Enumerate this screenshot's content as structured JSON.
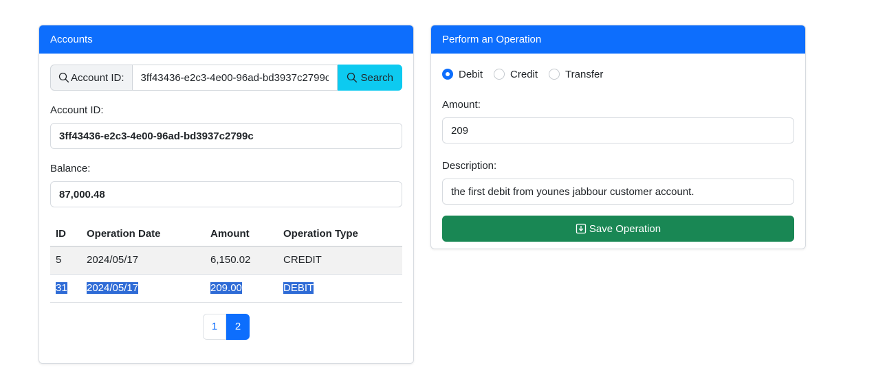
{
  "accounts": {
    "header": "Accounts",
    "search": {
      "label": "Account ID:",
      "value": "3ff43436-e2c3-4e00-96ad-bd3937c2799c",
      "button_label": "Search"
    },
    "account_id_label": "Account ID:",
    "account_id_value": "3ff43436-e2c3-4e00-96ad-bd3937c2799c",
    "balance_label": "Balance:",
    "balance_value": "87,000.48",
    "table": {
      "columns": [
        "ID",
        "Operation Date",
        "Amount",
        "Operation Type"
      ],
      "rows": [
        [
          "5",
          "2024/05/17",
          "6,150.02",
          "CREDIT"
        ],
        [
          "31",
          "2024/05/17",
          "209.00",
          "DEBIT"
        ]
      ]
    },
    "pagination": {
      "pages": [
        "1",
        "2"
      ],
      "active": "2"
    }
  },
  "operation": {
    "header": "Perform an Operation",
    "types": [
      {
        "label": "Debit",
        "checked": true
      },
      {
        "label": "Credit",
        "checked": false
      },
      {
        "label": "Transfer",
        "checked": false
      }
    ],
    "amount_label": "Amount:",
    "amount_value": "209",
    "description_label": "Description:",
    "description_value": "the first debit from younes jabbour customer account.",
    "save_label": "Save Operation"
  },
  "colors": {
    "primary": "#0d6efd",
    "info": "#0dcaf0",
    "success": "#198754",
    "selection": "#2e6bd6"
  },
  "icons": {
    "search": "search-icon",
    "save": "download-box-icon"
  }
}
